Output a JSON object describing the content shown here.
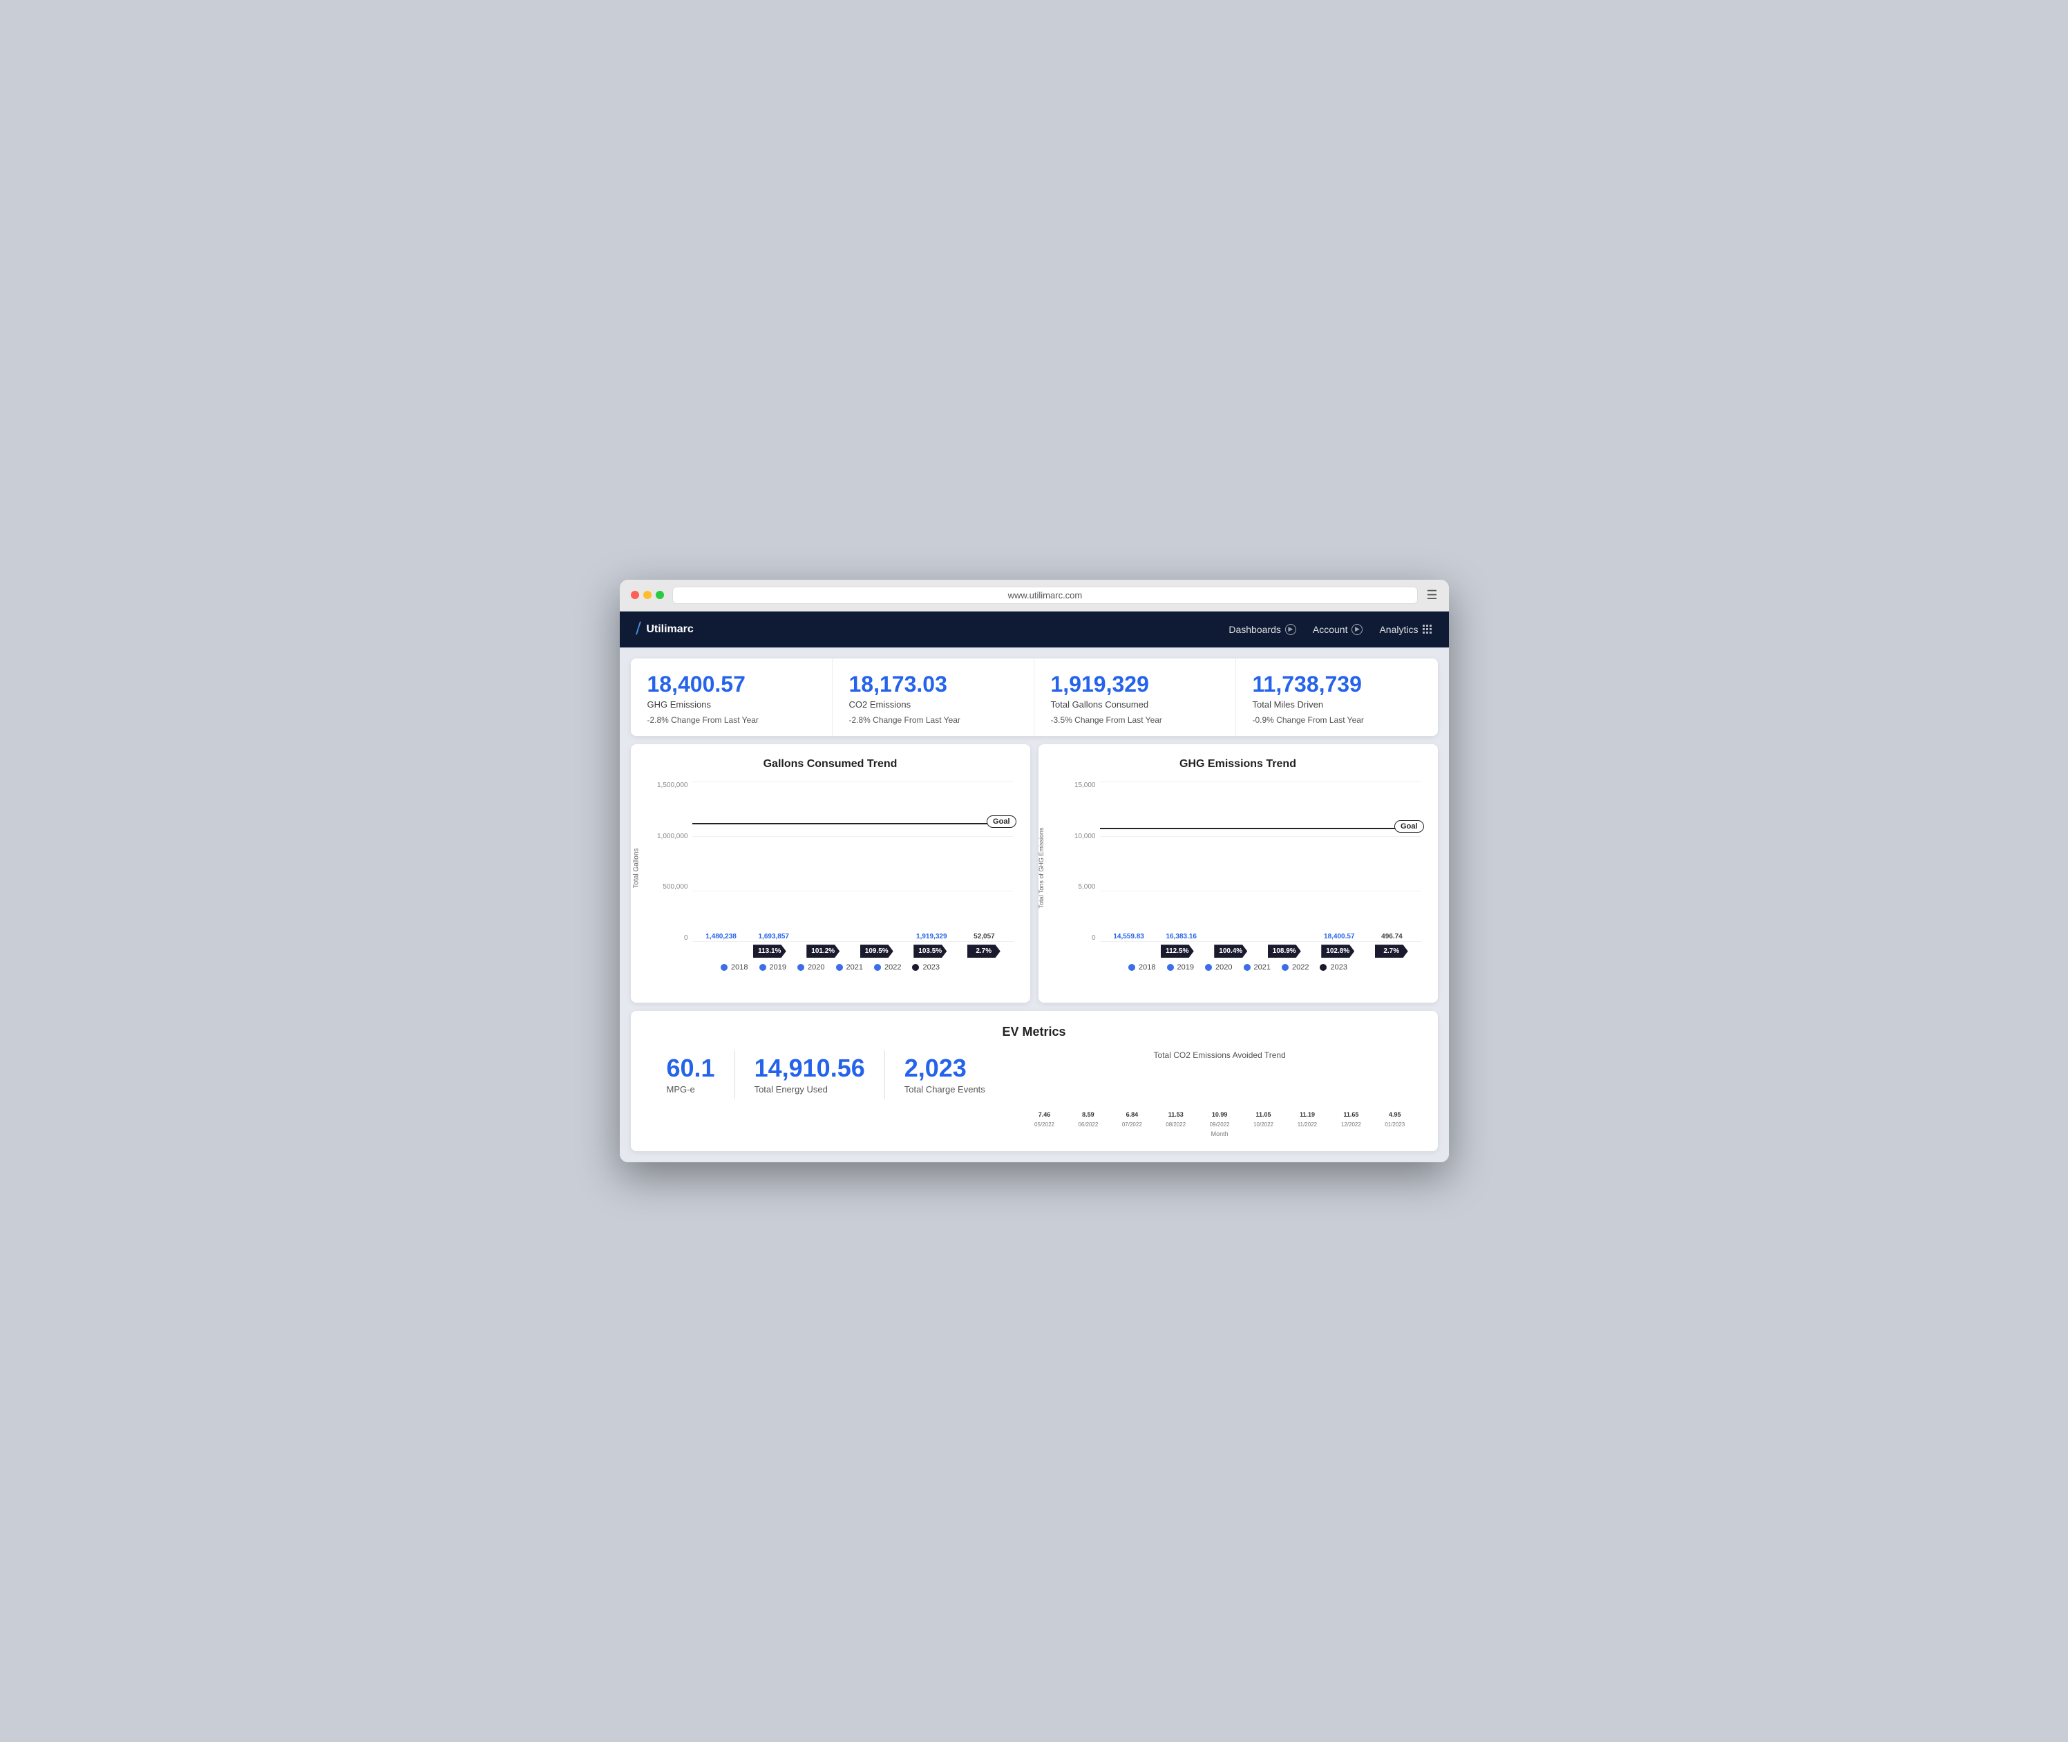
{
  "browser": {
    "url": "www.utilimarc.com"
  },
  "navbar": {
    "brand": "Utilimarc",
    "nav_items": [
      {
        "label": "Dashboards",
        "icon": "circle"
      },
      {
        "label": "Account",
        "icon": "circle"
      },
      {
        "label": "Analytics",
        "icon": "grid"
      }
    ]
  },
  "metrics": [
    {
      "value": "18,400.57",
      "label": "GHG Emissions",
      "change": "-2.8% Change From Last Year"
    },
    {
      "value": "18,173.03",
      "label": "CO2 Emissions",
      "change": "-2.8% Change From Last Year"
    },
    {
      "value": "1,919,329",
      "label": "Total Gallons Consumed",
      "change": "-3.5% Change From Last Year"
    },
    {
      "value": "11,738,739",
      "label": "Total Miles Driven",
      "change": "-0.9% Change From Last Year"
    }
  ],
  "gallons_chart": {
    "title": "Gallons Consumed Trend",
    "y_axis_title": "Total Gallons",
    "goal_label": "Goal",
    "y_labels": [
      "1,500,000",
      "1,000,000",
      "500,000",
      "0"
    ],
    "bars": [
      {
        "year": "2018",
        "value": "1,480,238",
        "height_pct": 75,
        "dark": false
      },
      {
        "year": "2019",
        "value": "1,693,857",
        "height_pct": 86,
        "dark": false
      },
      {
        "year": "2020",
        "value": "",
        "height_pct": 82,
        "dark": false
      },
      {
        "year": "2021",
        "value": "",
        "height_pct": 85,
        "dark": false
      },
      {
        "year": "2022",
        "value": "1,919,329",
        "height_pct": 97,
        "dark": false
      },
      {
        "year": "2023",
        "value": "52,057",
        "height_pct": 3,
        "dark": true
      }
    ],
    "arrows": [
      "113.1%",
      "101.2%",
      "109.5%",
      "103.5%",
      "2.7%"
    ],
    "last_bar_value": "52,057",
    "goal_line_pct": 75,
    "legend": [
      "2018",
      "2019",
      "2020",
      "2021",
      "2022",
      "2023"
    ]
  },
  "ghg_chart": {
    "title": "GHG Emissions Trend",
    "y_axis_title": "Total Tons of GHG Emissions",
    "goal_label": "Goal",
    "y_labels": [
      "15,000",
      "10,000",
      "5,000",
      "0"
    ],
    "bars": [
      {
        "year": "2018",
        "value": "14,559.83",
        "height_pct": 72,
        "dark": false
      },
      {
        "year": "2019",
        "value": "16,383.16",
        "height_pct": 82,
        "dark": false
      },
      {
        "year": "2020",
        "value": "",
        "height_pct": 78,
        "dark": false
      },
      {
        "year": "2021",
        "value": "",
        "height_pct": 83,
        "dark": false
      },
      {
        "year": "2022",
        "value": "18,400.57",
        "height_pct": 95,
        "dark": false
      },
      {
        "year": "2023",
        "value": "496.74",
        "height_pct": 3,
        "dark": true
      }
    ],
    "arrows": [
      "112.5%",
      "100.4%",
      "108.9%",
      "102.8%",
      "2.7%"
    ],
    "last_bar_value": "496.74",
    "goal_line_pct": 72,
    "legend": [
      "2018",
      "2019",
      "2020",
      "2021",
      "2022",
      "2023"
    ]
  },
  "ev_metrics": {
    "title": "EV Metrics",
    "stats": [
      {
        "value": "60.1",
        "label": "MPG-e"
      },
      {
        "value": "14,910.56",
        "label": "Total Energy Used"
      },
      {
        "value": "2,023",
        "label": "Total Charge Events"
      }
    ],
    "chart_title": "Total CO2 Emissions Avoided Trend",
    "x_label": "Month",
    "bars": [
      {
        "month": "05/2022",
        "value": "7.46",
        "height_pct": 60
      },
      {
        "month": "06/2022",
        "value": "8.59",
        "height_pct": 69
      },
      {
        "month": "07/2022",
        "value": "6.84",
        "height_pct": 55
      },
      {
        "month": "08/2022",
        "value": "11.53",
        "height_pct": 93
      },
      {
        "month": "09/2022",
        "value": "10.99",
        "height_pct": 89
      },
      {
        "month": "10/2022",
        "value": "11.05",
        "height_pct": 89
      },
      {
        "month": "11/2022",
        "value": "11.19",
        "height_pct": 90
      },
      {
        "month": "12/2022",
        "value": "11.65",
        "height_pct": 94
      },
      {
        "month": "01/2023",
        "value": "4.95",
        "height_pct": 40
      }
    ]
  }
}
